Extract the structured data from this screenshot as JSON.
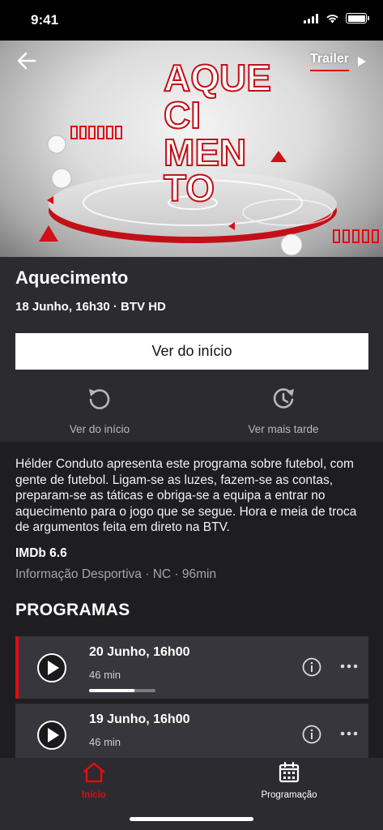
{
  "status_bar": {
    "time": "9:41"
  },
  "hero": {
    "logo_lines": [
      "AQUE",
      "CI",
      "MEN",
      "TO"
    ],
    "trailer_label": "Trailer",
    "accent_color": "#e10b13"
  },
  "program": {
    "title": "Aquecimento",
    "date_time": "18 Junho, 16h30 · ",
    "channel": "BTV HD",
    "primary_button": "Ver do início",
    "actions": [
      {
        "label": "Ver do início",
        "icon": "restart-icon"
      },
      {
        "label": "Ver mais tarde",
        "icon": "watch-later-icon"
      }
    ],
    "description": "Hélder Conduto apresenta este programa sobre futebol, com gente de futebol. Ligam-se as luzes, fazem-se as contas, preparam-se as táticas e obriga-se a equipa a entrar no aquecimento para o jogo que se segue. Hora e meia de troca de argumentos feita em direto na BTV.",
    "imdb": "IMDb 6.6",
    "genre_line": "Informação Desportiva · NC · 96min"
  },
  "programs_section": {
    "title": "PROGRAMAS",
    "episodes": [
      {
        "date": "20 Junho, 16h00",
        "duration": "46 min",
        "progress": 0.68,
        "active": true
      },
      {
        "date": "19 Junho, 16h00",
        "duration": "46 min",
        "active": false
      }
    ]
  },
  "tab_bar": {
    "tabs": [
      {
        "label": "Início",
        "icon": "home-icon",
        "active": true,
        "color": "#e10b13"
      },
      {
        "label": "Programação",
        "icon": "calendar-icon",
        "active": false,
        "color": "#ffffff"
      }
    ]
  }
}
